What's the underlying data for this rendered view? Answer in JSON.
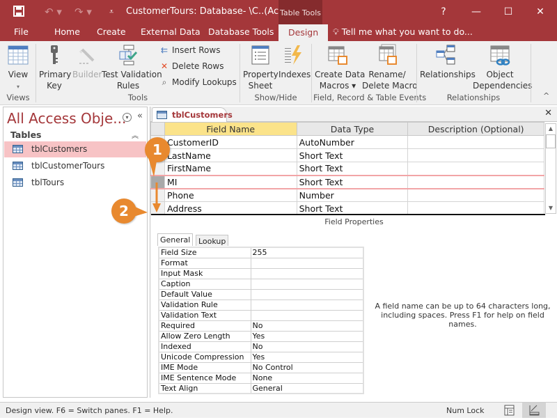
{
  "titlebar": {
    "title": "CustomerTours: Database- \\C..(Acces...",
    "context_tab_group": "Table Tools",
    "quick_access": [
      "save-icon",
      "undo-icon",
      "redo-icon",
      "customize-qat-icon"
    ],
    "window_buttons": {
      "help": "?",
      "minimize": "—",
      "maximize": "☐",
      "close": "✕"
    }
  },
  "ribbon_tabs": [
    {
      "label": "File"
    },
    {
      "label": "Home"
    },
    {
      "label": "Create"
    },
    {
      "label": "External Data"
    },
    {
      "label": "Database Tools"
    },
    {
      "label": "Design",
      "active": true
    }
  ],
  "tell_me": "Tell me what you want to do...",
  "ribbon": {
    "groups": [
      {
        "label": "Views",
        "buttons": [
          {
            "label": "View",
            "sub": "▾"
          }
        ]
      },
      {
        "label": "Tools",
        "buttons": [
          {
            "label": "Primary",
            "label2": "Key"
          },
          {
            "label": "Builder",
            "disabled": true
          },
          {
            "label": "Test Validation",
            "label2": "Rules"
          },
          {
            "label": "Insert Rows"
          },
          {
            "label": "Delete Rows"
          },
          {
            "label": "Modify Lookups"
          }
        ]
      },
      {
        "label": "Show/Hide",
        "buttons": [
          {
            "label": "Property",
            "label2": "Sheet"
          },
          {
            "label": "Indexes"
          }
        ]
      },
      {
        "label": "Field, Record & Table Events",
        "buttons": [
          {
            "label": "Create Data",
            "label2": "Macros ▾"
          },
          {
            "label": "Rename/",
            "label2": "Delete Macro"
          }
        ]
      },
      {
        "label": "Relationships",
        "buttons": [
          {
            "label": "Relationships"
          },
          {
            "label": "Object",
            "label2": "Dependencies"
          }
        ]
      }
    ],
    "collapse": "^"
  },
  "nav_pane": {
    "title": "All Access Obje...",
    "section": "Tables",
    "items": [
      {
        "label": "tblCustomers",
        "selected": true
      },
      {
        "label": "tblCustomerTours"
      },
      {
        "label": "tblTours"
      }
    ]
  },
  "document": {
    "tab_label": "tblCustomers",
    "columns": [
      "Field Name",
      "Data Type",
      "Description (Optional)"
    ],
    "rows": [
      {
        "field": "CustomerID",
        "type": "AutoNumber",
        "desc": ""
      },
      {
        "field": "LastName",
        "type": "Short Text",
        "desc": ""
      },
      {
        "field": "FirstName",
        "type": "Short Text",
        "desc": ""
      },
      {
        "field": "MI",
        "type": "Short Text",
        "desc": "",
        "highlighted": true
      },
      {
        "field": "Phone",
        "type": "Number",
        "desc": ""
      },
      {
        "field": "Address",
        "type": "Short Text",
        "desc": ""
      }
    ],
    "field_properties_title": "Field Properties",
    "property_tabs": [
      "General",
      "Lookup"
    ],
    "properties": [
      {
        "name": "Field Size",
        "value": "255"
      },
      {
        "name": "Format",
        "value": ""
      },
      {
        "name": "Input Mask",
        "value": ""
      },
      {
        "name": "Caption",
        "value": ""
      },
      {
        "name": "Default Value",
        "value": ""
      },
      {
        "name": "Validation Rule",
        "value": ""
      },
      {
        "name": "Validation Text",
        "value": ""
      },
      {
        "name": "Required",
        "value": "No"
      },
      {
        "name": "Allow Zero Length",
        "value": "Yes"
      },
      {
        "name": "Indexed",
        "value": "No"
      },
      {
        "name": "Unicode Compression",
        "value": "Yes"
      },
      {
        "name": "IME Mode",
        "value": "No Control"
      },
      {
        "name": "IME Sentence Mode",
        "value": "None"
      },
      {
        "name": "Text Align",
        "value": "General"
      }
    ],
    "hint": "A field name can be up to 64 characters long, including spaces. Press F1 for help on field names."
  },
  "callouts": [
    "1",
    "2"
  ],
  "colors": {
    "accent": "#a4373a",
    "callout": "#e8892f",
    "selection": "#f7c3c5",
    "header_highlight": "#fbe38a"
  },
  "statusbar": {
    "text": "Design view.  F6 = Switch panes.  F1 = Help.",
    "num_lock": "Num Lock"
  }
}
